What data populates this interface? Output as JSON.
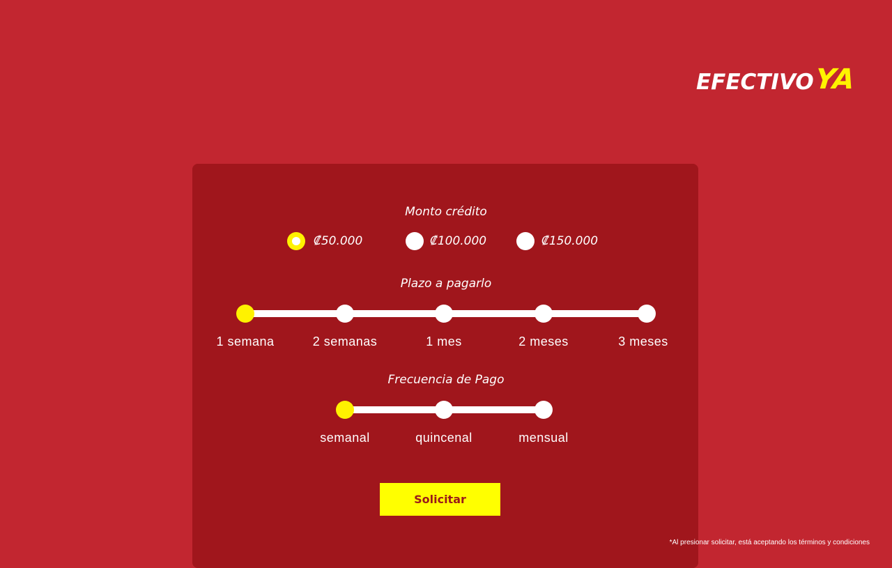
{
  "brand": {
    "name_main": "EFECTIVO",
    "name_accent": "YA"
  },
  "monto": {
    "title": "Monto crédito",
    "options": [
      {
        "label": "₡50.000",
        "selected": true
      },
      {
        "label": "₡100.000",
        "selected": false
      },
      {
        "label": "₡150.000",
        "selected": false
      }
    ]
  },
  "plazo": {
    "title": "Plazo a pagarlo",
    "steps": [
      "1 semana",
      "2 semanas",
      "1 mes",
      "2 meses",
      "3 meses"
    ],
    "selected_index": 0
  },
  "frecuencia": {
    "title": "Frecuencia de Pago",
    "steps": [
      "semanal",
      "quincenal",
      "mensual"
    ],
    "selected_index": 0
  },
  "submit_label": "Solicitar",
  "disclaimer": "*Al presionar solicitar, está aceptando los términos y condiciones",
  "colors": {
    "background": "#c22630",
    "card": "#a0161c",
    "accent": "#fff200"
  }
}
